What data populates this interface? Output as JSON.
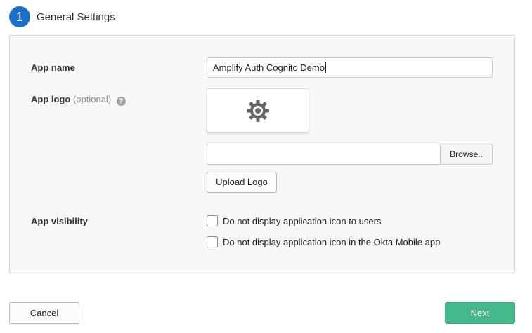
{
  "step": {
    "number": "1",
    "title": "General Settings"
  },
  "fields": {
    "app_name": {
      "label": "App name",
      "value": "Amplify Auth Cognito Demo"
    },
    "app_logo": {
      "label": "App logo",
      "optional_text": "(optional)",
      "help_icon_text": "?",
      "browse_label": "Browse..",
      "upload_label": "Upload Logo",
      "file_value": ""
    },
    "app_visibility": {
      "label": "App visibility",
      "options": [
        {
          "label": "Do not display application icon to users",
          "checked": false
        },
        {
          "label": "Do not display application icon in the Okta Mobile app",
          "checked": false
        }
      ]
    }
  },
  "footer": {
    "cancel_label": "Cancel",
    "next_label": "Next"
  },
  "colors": {
    "step_badge": "#1a6fc6",
    "next_button": "#46b98c",
    "panel_background": "#f7f7f7"
  },
  "icons": {
    "logo_placeholder": "gear-icon",
    "help": "help-icon"
  }
}
